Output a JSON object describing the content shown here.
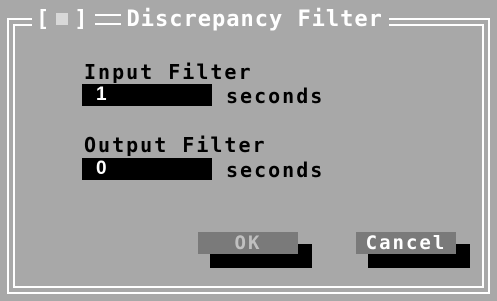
{
  "dialog": {
    "close_box": "[■]",
    "title": "Discrepancy Filter"
  },
  "input_filter": {
    "label": "Input Filter",
    "value": "1",
    "unit": "seconds"
  },
  "output_filter": {
    "label": "Output Filter",
    "value": "0",
    "unit": "seconds"
  },
  "buttons": {
    "ok": "OK",
    "cancel": "Cancel"
  },
  "colors": {
    "background": "#a8a8a8",
    "frame": "#ffffff",
    "field": "#000000",
    "ok_button": "#7a7a7a",
    "ok_text": "#c0c0c0",
    "cancel_button": "#7a7a7a",
    "cancel_text": "#ffffff"
  }
}
